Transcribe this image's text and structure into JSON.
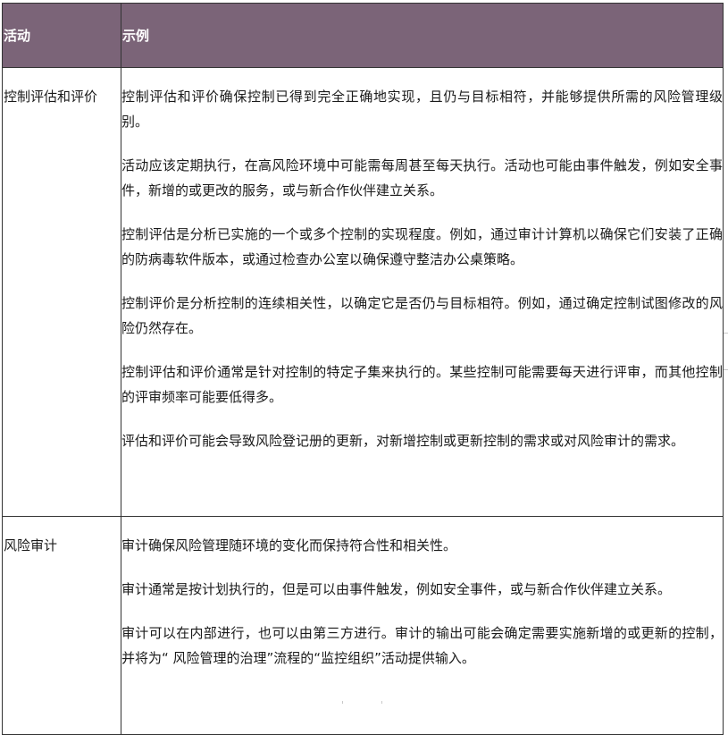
{
  "table": {
    "headers": {
      "activity": "活动",
      "example": "示例"
    },
    "rows": [
      {
        "activity": "控制评估和评价",
        "paragraphs": [
          "控制评估和评价确保控制已得到完全正确地实现，且仍与目标相符，并能够提供所需的风险管理级别。",
          "活动应该定期执行，在高风险环境中可能需每周甚至每天执行。活动也可能由事件触发，例如安全事件，新增的或更改的服务，或与新合作伙伴建立关系。",
          "控制评估是分析已实施的一个或多个控制的实现程度。例如，通过审计计算机以确保它们安装了正确的防病毒软件版本，或通过检查办公室以确保遵守整洁办公桌策略。",
          "控制评价是分析控制的连续相关性，以确定它是否仍与目标相符。例如，通过确定控制试图修改的风险仍然存在。",
          "控制评估和评价通常是针对控制的特定子集来执行的。某些控制可能需要每天进行评审，而其他控制的评审频率可能要低得多。",
          "评估和评价可能会导致风险登记册的更新，对新增控制或更新控制的需求或对风险审计的需求。"
        ]
      },
      {
        "activity": "风险审计",
        "paragraphs": [
          "审计确保风险管理随环境的变化而保持符合性和相关性。",
          "审计通常是按计划执行的，但是可以由事件触发，例如安全事件，或与新合作伙伴建立关系。",
          "审计可以在内部进行，也可以由第三方进行。审计的输出可能会确定需要实施新增的或更新的控制，并将为“ 风险管理的治理”流程的“监控组织”活动提供输入。"
        ]
      }
    ]
  },
  "colors": {
    "header_bg": "#7b6478",
    "header_text": "#ffffff",
    "border": "#333333"
  }
}
